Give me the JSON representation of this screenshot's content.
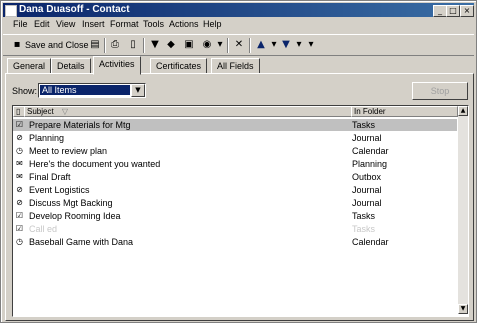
{
  "window": {
    "title": "Dana Duasoff - Contact",
    "controls": {
      "minimize": "_",
      "maximize": "□",
      "close": "×"
    }
  },
  "menu": [
    "File",
    "Edit",
    "View",
    "Insert",
    "Format",
    "Tools",
    "Actions",
    "Help"
  ],
  "toolbar": {
    "save_close_label": "Save and Close",
    "icons": [
      "save-icon",
      "print-icon",
      "flag-icon",
      "categories-icon",
      "delete-icon",
      "previous-item-icon",
      "next-item-icon"
    ]
  },
  "tabs": [
    "General",
    "Details",
    "Activities",
    "Certificates",
    "All Fields"
  ],
  "active_tab": "Activities",
  "show": {
    "label": "Show:",
    "value": "All Items"
  },
  "new_button_label": "Stop",
  "list": {
    "columns": [
      "Subject",
      "In Folder"
    ],
    "rows": [
      {
        "subject": "Prepare Materials for Mtg",
        "folder": "Tasks",
        "icon": "task-icon",
        "selected": true
      },
      {
        "subject": "Planning",
        "folder": "Journal",
        "icon": "journal-icon"
      },
      {
        "subject": "Meet to review plan",
        "folder": "Calendar",
        "icon": "appointment-icon"
      },
      {
        "subject": "Here's the document you wanted",
        "folder": "Planning",
        "icon": "message-icon"
      },
      {
        "subject": "Final Draft",
        "folder": "Outbox",
        "icon": "message-icon"
      },
      {
        "subject": "Event Logistics",
        "folder": "Journal",
        "icon": "journal-icon"
      },
      {
        "subject": "Discuss Mgt Backing",
        "folder": "Journal",
        "icon": "journal-icon"
      },
      {
        "subject": "Develop Rooming Idea",
        "folder": "Tasks",
        "icon": "task-icon"
      },
      {
        "subject": "Call ed",
        "folder": "Tasks",
        "icon": "task-icon",
        "faded": true
      },
      {
        "subject": "Baseball Game with Dana",
        "folder": "Calendar",
        "icon": "appointment-icon"
      }
    ]
  },
  "colors": {
    "titlebar": "#0a246a",
    "chrome": "#d4d0c8",
    "selection": "#0a246a"
  }
}
